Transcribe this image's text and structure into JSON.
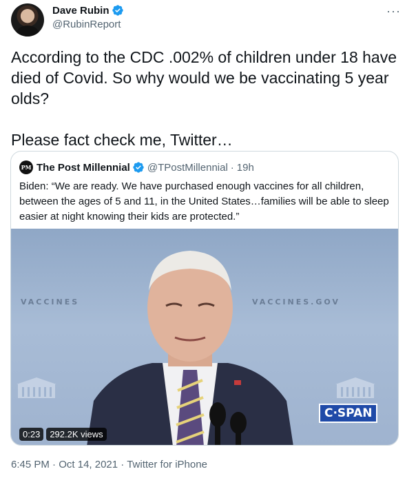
{
  "author": {
    "name": "Dave Rubin",
    "handle": "@RubinReport"
  },
  "more_label": "···",
  "tweet_text": "According to the CDC .002% of children under 18 have died of Covid. So why would we be vaccinating 5 year olds?\n\nPlease fact check me, Twitter…",
  "quote": {
    "avatar_text": "PM",
    "name": "The Post Millennial",
    "handle": "@TPostMillennial",
    "separator": "·",
    "time": "19h",
    "text": "Biden: “We are ready. We have purchased enough vaccines for all children, between the ages of 5 and 11, in the United States…families will be able to sleep easier at night knowing their kids are protected.”",
    "video": {
      "duration": "0:23",
      "views": "292.2K views",
      "watermark": "C·SPAN",
      "background_words": [
        "VACCINES",
        "VACCINES.GOV"
      ]
    }
  },
  "footer": {
    "time": "6:45 PM",
    "sep1": "·",
    "date": "Oct 14, 2021",
    "sep2": "·",
    "source": "Twitter for iPhone"
  },
  "colors": {
    "verified_blue": "#1d9bf0",
    "secondary_text": "#536471",
    "border": "#cfd9de",
    "cspan_blue": "#1f4aa8"
  }
}
